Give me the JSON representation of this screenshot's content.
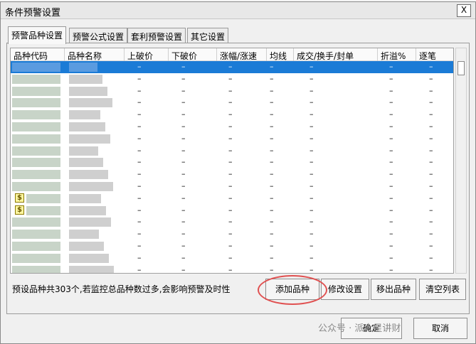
{
  "dialog": {
    "title": "条件预警设置",
    "close_label": "X"
  },
  "tabs": [
    {
      "label": "预警品种设置",
      "active": true
    },
    {
      "label": "预警公式设置",
      "active": false
    },
    {
      "label": "套利预警设置",
      "active": false
    },
    {
      "label": "其它设置",
      "active": false
    }
  ],
  "table": {
    "columns": [
      "品种代码",
      "品种名称",
      "上破价",
      "下破价",
      "涨幅/涨速",
      "均线",
      "成交/换手/封单",
      "折溢%",
      "逐笔"
    ],
    "dash": "–",
    "row_count": 21,
    "selected_row": 0,
    "icon_rows": [
      11,
      12
    ]
  },
  "icons": {
    "dollar": "dollar-icon",
    "dollar_glyph": "$"
  },
  "info_text": "预设品种共303个,若监控总品种数过多,会影响预警及时性",
  "buttons": {
    "add": "添加品种",
    "edit": "修改设置",
    "remove": "移出品种",
    "clear": "清空列表",
    "ok": "确定",
    "cancel": "取消"
  },
  "watermark": "公众号 · 派大星讲财",
  "colors": {
    "selection": "#1b7bd6",
    "highlight_ring": "#e05050"
  }
}
